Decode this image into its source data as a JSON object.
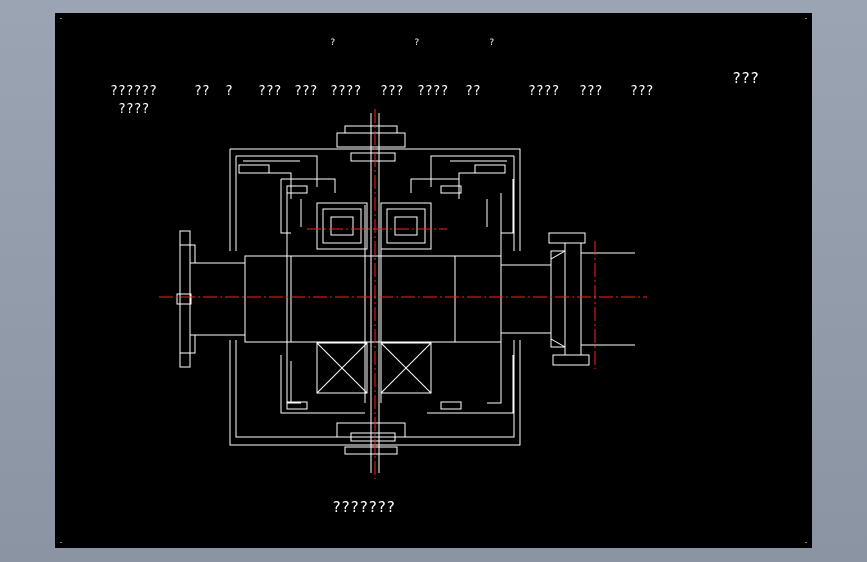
{
  "colors": {
    "background": "#000000",
    "lines": "#ffffff",
    "centerline": "#ff2020",
    "viewport_frame": "#9aa4b3"
  },
  "top_marks": [
    "?",
    "?",
    "?"
  ],
  "header_row": [
    "??????",
    "??",
    "?",
    "???",
    "???",
    "????",
    "???",
    "????",
    "??",
    "????",
    "???",
    "???"
  ],
  "header_row2": "????",
  "corner_label": "???",
  "bottom_label": "???????"
}
